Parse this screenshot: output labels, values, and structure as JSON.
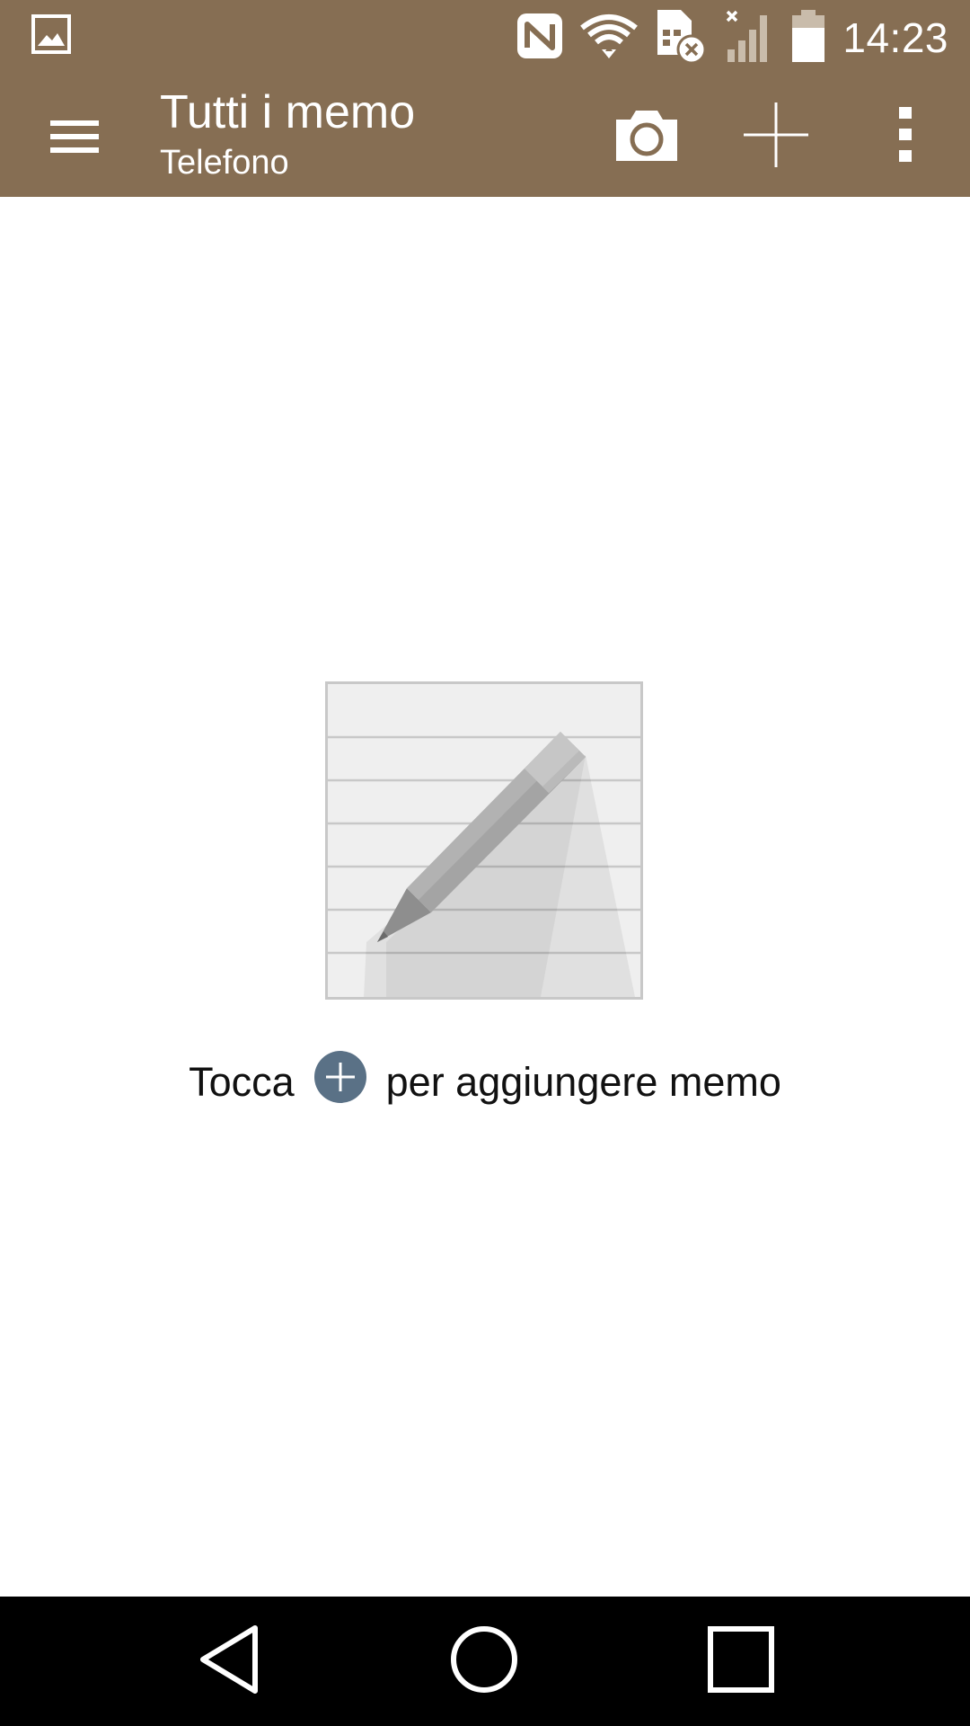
{
  "status_bar": {
    "time": "14:23",
    "icons": [
      "image-notification-icon",
      "nfc-icon",
      "wifi-icon",
      "sim-error-icon",
      "signal-icon",
      "battery-icon"
    ]
  },
  "toolbar": {
    "title": "Tutti i memo",
    "subtitle": "Telefono",
    "actions": [
      "menu-icon",
      "camera-icon",
      "add-icon",
      "more-vert-icon"
    ]
  },
  "empty_state": {
    "hint_before": "Tocca",
    "hint_after": "per aggiungere memo",
    "illustration": "notepad-pencil-icon"
  },
  "nav_bar": {
    "buttons": [
      "back-icon",
      "home-icon",
      "recents-icon"
    ]
  },
  "colors": {
    "app_bar": "#866e53",
    "hint_icon": "#5a7186",
    "nav_bar": "#000000"
  }
}
